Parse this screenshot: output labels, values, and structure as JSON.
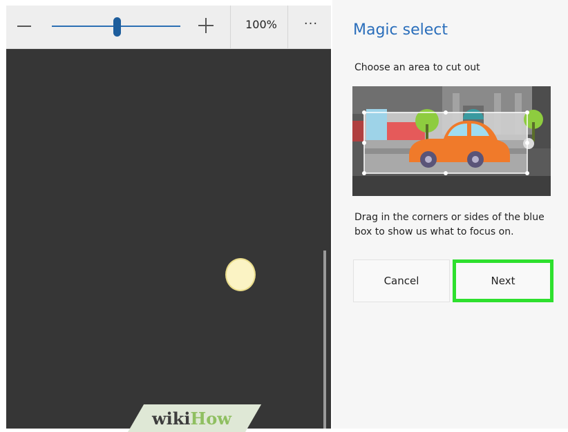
{
  "toolbar": {
    "zoom_value": "100%",
    "more_label": "···"
  },
  "panel": {
    "title": "Magic select",
    "subtitle": "Choose an area to cut out",
    "help_text": "Drag in the corners or sides of the blue box to show us what to focus on.",
    "cancel_label": "Cancel",
    "next_label": "Next"
  },
  "watermark": {
    "part1": "wiki",
    "part2": "How"
  },
  "colors": {
    "accent": "#2a6ebb",
    "highlight": "#2ee02e",
    "canvas": "#363636"
  }
}
